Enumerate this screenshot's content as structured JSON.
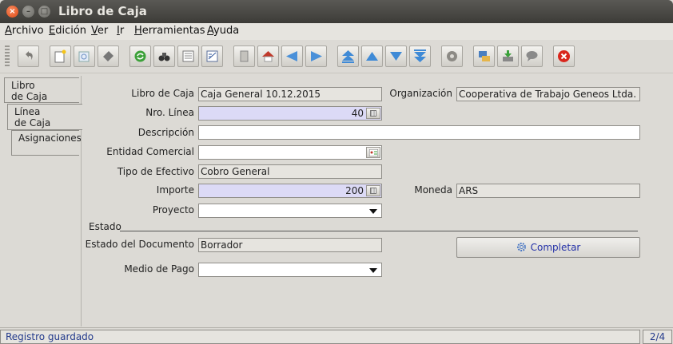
{
  "window": {
    "title": "Libro de Caja"
  },
  "menu": [
    "Archivo",
    "Edición",
    "Ver",
    "Ir",
    "Herramientas",
    "Ayuda"
  ],
  "toolbar": {
    "buttons": [
      "undo-icon",
      "new-record-icon",
      "copy-record-icon",
      "delete-record-icon",
      "refresh-icon",
      "find-icon",
      "history-icon",
      "report-icon",
      "attachment-icon",
      "home-icon",
      "previous-icon",
      "next-icon",
      "first-icon",
      "up-icon",
      "down-icon",
      "last-icon",
      "workflow-icon",
      "print-icon",
      "export-icon",
      "chat-icon",
      "close-window-icon"
    ]
  },
  "tabs": [
    {
      "line1": "Libro",
      "line2": "de Caja"
    },
    {
      "line1": "Línea",
      "line2": "de Caja"
    },
    {
      "line1": "Asignaciones",
      "line2": ""
    }
  ],
  "form": {
    "cash_journal_label": "Libro de Caja",
    "cash_journal_value": "Caja General 10.12.2015",
    "organization_label": "Organización",
    "organization_value": "Cooperativa de Trabajo Geneos Ltda.",
    "line_no_label": "Nro. Línea",
    "line_no_value": "40",
    "description_label": "Descripción",
    "description_value": "",
    "business_partner_label": "Entidad Comercial",
    "business_partner_value": "",
    "cash_type_label": "Tipo de Efectivo",
    "cash_type_value": "Cobro General",
    "amount_label": "Importe",
    "amount_value": "200",
    "currency_label": "Moneda",
    "currency_value": "ARS",
    "project_label": "Proyecto",
    "project_value": "",
    "status_section": "Estado",
    "doc_status_label": "Estado del Documento",
    "doc_status_value": "Borrador",
    "complete_button": "Completar",
    "payment_method_label": "Medio de Pago",
    "payment_method_value": ""
  },
  "status": {
    "message": "Registro guardado",
    "record": "2/4"
  },
  "colors": {
    "mandatory_field": "#dcdaf6",
    "readonly_field": "#e6e4df",
    "link_text": "#2431a8"
  }
}
